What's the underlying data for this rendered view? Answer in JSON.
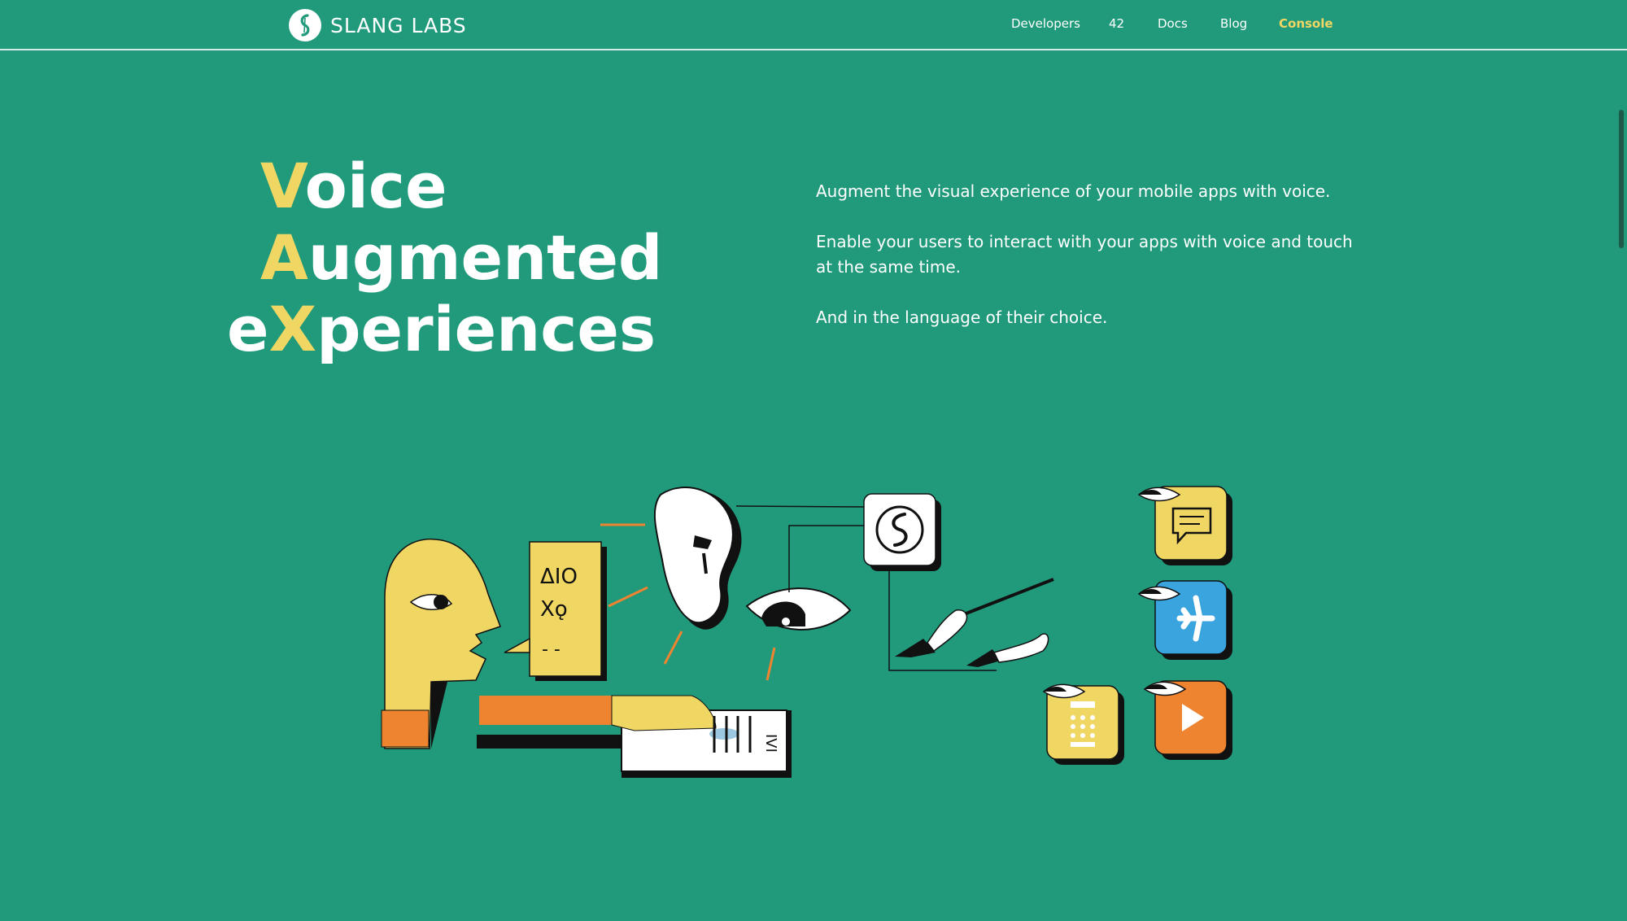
{
  "brand": {
    "name": "SLANG LABS",
    "logo_icon": "slang-logo-icon"
  },
  "nav": {
    "items": [
      {
        "label": "Developers"
      },
      {
        "label": "42"
      },
      {
        "label": "Docs"
      },
      {
        "label": "Blog"
      },
      {
        "label": "Console"
      }
    ]
  },
  "hero": {
    "line1": {
      "accent": "V",
      "rest": "oice"
    },
    "line2": {
      "accent": "A",
      "rest": "ugmented"
    },
    "line3": {
      "pre": "e",
      "accent": "X",
      "rest": "periences"
    },
    "paragraphs": [
      "Augment the visual experience of your mobile apps with voice.",
      "Enable your users to interact with your apps with voice and touch at the same time.",
      "And in the language of their choice."
    ]
  },
  "colors": {
    "background": "#219a7c",
    "accent_yellow": "#f0d662",
    "accent_orange": "#ee8330",
    "accent_blue": "#3aa4df"
  },
  "illustration": {
    "icons": [
      "speaking-head-icon",
      "speech-bubble-symbols-icon",
      "ear-icon",
      "eye-icon",
      "slang-logo-icon",
      "conductor-hands-icon",
      "touch-screen-icon",
      "chat-app-icon",
      "airplane-app-icon",
      "calculator-app-icon",
      "play-app-icon"
    ]
  }
}
